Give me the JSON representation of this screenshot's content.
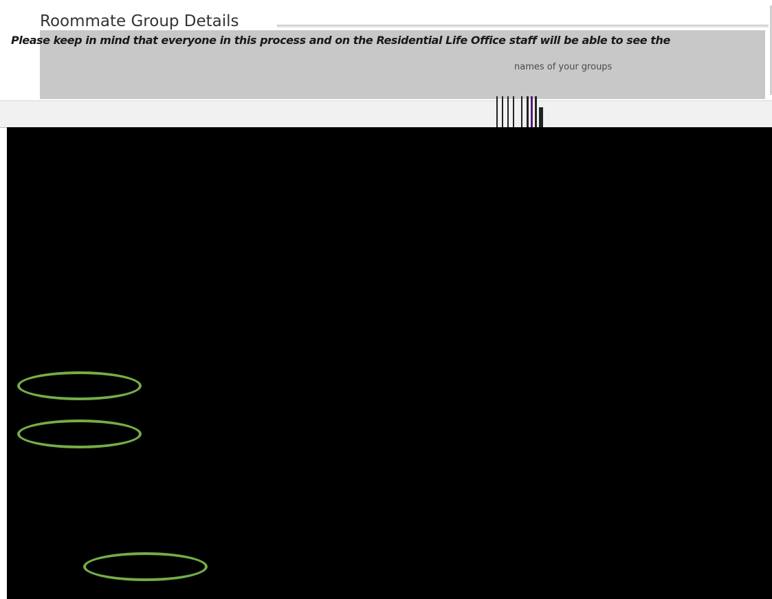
{
  "section": {
    "title": "Roommate Group Details"
  },
  "notice": {
    "line1": "Please keep in mind that everyone in this process and on the Residential Life Office staff will be able to see the",
    "line2_fragment": "names of your groups"
  },
  "highlights": [
    {
      "name": "highlight-ellipse-1"
    },
    {
      "name": "highlight-ellipse-2"
    },
    {
      "name": "highlight-ellipse-3"
    }
  ],
  "colors": {
    "highlight": "#74ad48",
    "notice_background": "#c8c8c8",
    "redaction": "#000000"
  }
}
